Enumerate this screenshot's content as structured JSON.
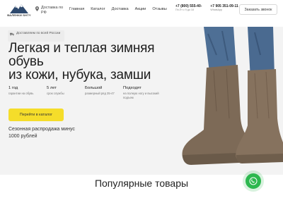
{
  "header": {
    "logo_text": "ВАЛЕНКИ SHTY",
    "delivery": "Доставка по РФ",
    "nav": [
      "Главная",
      "Каталог",
      "Доставка",
      "Акции",
      "Отзывы"
    ],
    "phones": [
      {
        "number": "+7 (800) 555-40-",
        "sub": "Пн-Пт с 9 до 18"
      },
      {
        "number": "+7 905 351-09-11",
        "sub": "WhatsApp"
      }
    ],
    "callback": "Заказать звонок"
  },
  "hero": {
    "badge": "Доставляем по всей России",
    "title_line1": "Легкая и теплая зимняя обувь",
    "title_line2": "из кожи, нубука, замши",
    "features": [
      {
        "value": "1 год",
        "desc": "гарантии на обувь"
      },
      {
        "value": "5 лет",
        "desc": "срок службы"
      },
      {
        "value": "Большой",
        "desc": "размерный ряд 35-47"
      },
      {
        "value": "Подходят",
        "desc": "на полную ногу и высокий подъем"
      }
    ],
    "catalog_button": "Перейти в каталог",
    "sale": "Сезонная распродажа минус 1000 рублей"
  },
  "section": {
    "title": "Популярные товары"
  },
  "colors": {
    "accent": "#f5dd2a",
    "whatsapp": "#2db84f",
    "hero_bg": "#f3f3f3"
  }
}
